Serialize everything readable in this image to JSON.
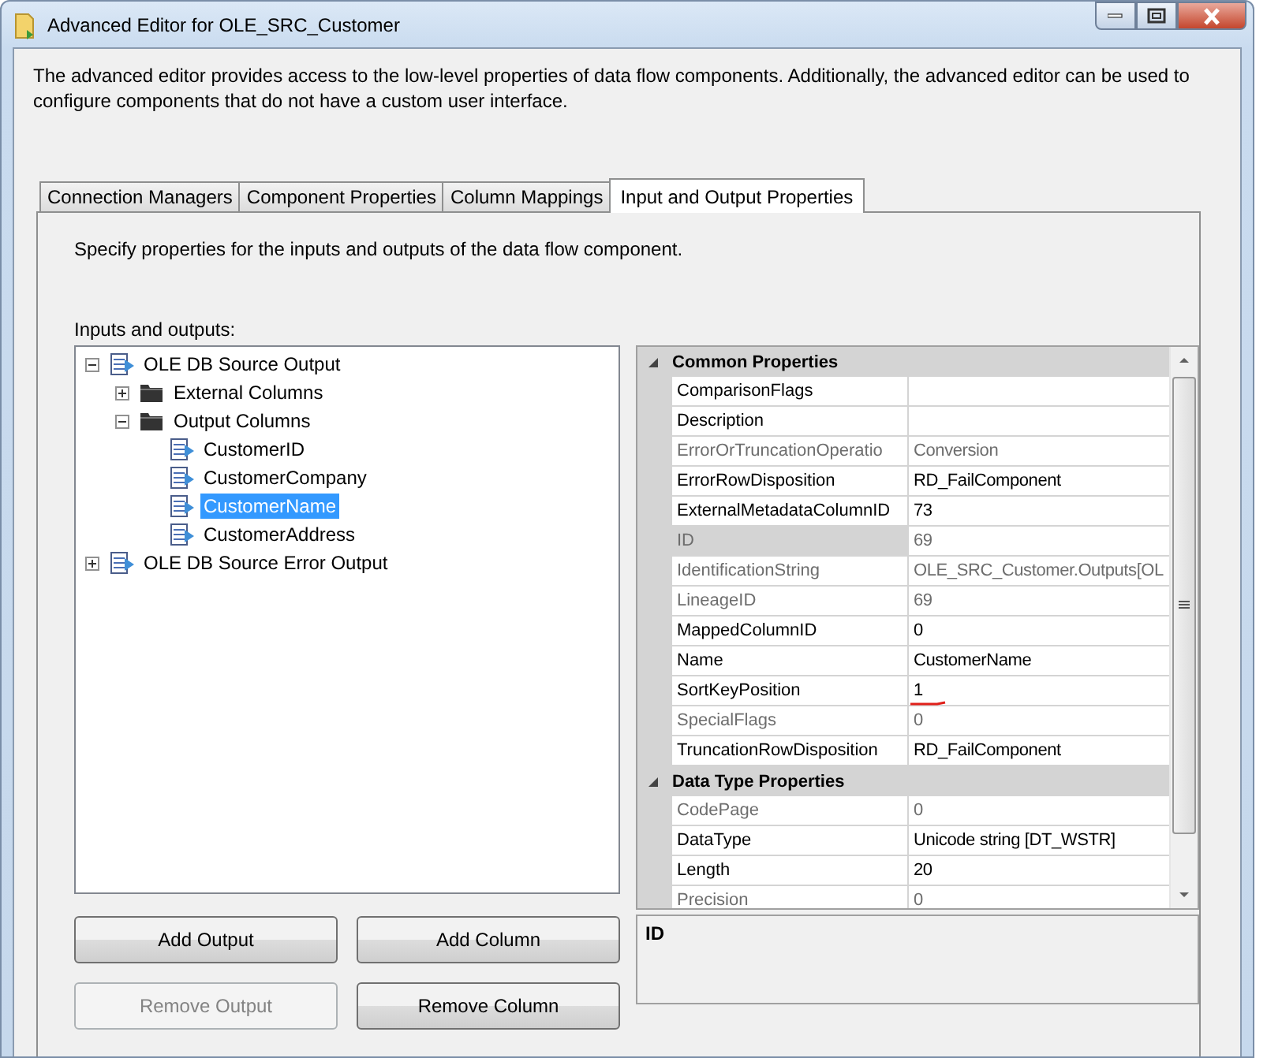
{
  "window": {
    "title": "Advanced Editor for OLE_SRC_Customer"
  },
  "intro": "The advanced editor provides access to the low-level properties of data flow components. Additionally, the advanced editor can be used to configure components that do not have a custom user interface.",
  "tabs": [
    {
      "label": "Connection Managers",
      "selected": false
    },
    {
      "label": "Component Properties",
      "selected": false
    },
    {
      "label": "Column Mappings",
      "selected": false
    },
    {
      "label": "Input and Output Properties",
      "selected": true
    }
  ],
  "panel_hint": "Specify properties for the inputs and outputs of the data flow component.",
  "tree_label": "Inputs and outputs:",
  "tree": [
    {
      "label": "OLE DB Source Output",
      "kind": "output",
      "expanded": true,
      "selected": false,
      "children": [
        {
          "label": "External Columns",
          "kind": "folder",
          "expanded": false,
          "selected": false
        },
        {
          "label": "Output Columns",
          "kind": "folder",
          "expanded": true,
          "selected": false,
          "children": [
            {
              "label": "CustomerID",
              "kind": "column",
              "selected": false
            },
            {
              "label": "CustomerCompany",
              "kind": "column",
              "selected": false
            },
            {
              "label": "CustomerName",
              "kind": "column",
              "selected": true
            },
            {
              "label": "CustomerAddress",
              "kind": "column",
              "selected": false
            }
          ]
        }
      ]
    },
    {
      "label": "OLE DB Source Error Output",
      "kind": "output",
      "expanded": false,
      "selected": false
    }
  ],
  "properties": [
    {
      "kind": "category",
      "label": "Common Properties",
      "expanded": true
    },
    {
      "kind": "property",
      "name": "ComparisonFlags",
      "disabled": false,
      "selected": false,
      "annotated": false
    },
    {
      "kind": "property",
      "name": "Description",
      "disabled": false,
      "selected": false,
      "annotated": false
    },
    {
      "kind": "property",
      "name": "ErrorOrTruncationOperatio",
      "value": "Conversion",
      "disabled": true,
      "selected": false,
      "annotated": false
    },
    {
      "kind": "property",
      "name": "ErrorRowDisposition",
      "value": "RD_FailComponent",
      "disabled": false,
      "selected": false,
      "annotated": false
    },
    {
      "kind": "property",
      "name": "ExternalMetadataColumnID",
      "value": "73",
      "disabled": false,
      "selected": false,
      "annotated": false
    },
    {
      "kind": "property",
      "name": "ID",
      "value": "69",
      "disabled": true,
      "selected": true,
      "annotated": false
    },
    {
      "kind": "property",
      "name": "IdentificationString",
      "value": "OLE_SRC_Customer.Outputs[OL",
      "disabled": true,
      "selected": false,
      "annotated": false
    },
    {
      "kind": "property",
      "name": "LineageID",
      "value": "69",
      "disabled": true,
      "selected": false,
      "annotated": false
    },
    {
      "kind": "property",
      "name": "MappedColumnID",
      "value": "0",
      "disabled": false,
      "selected": false,
      "annotated": false
    },
    {
      "kind": "property",
      "name": "Name",
      "value": "CustomerName",
      "disabled": false,
      "selected": false,
      "annotated": false
    },
    {
      "kind": "property",
      "name": "SortKeyPosition",
      "value": "1",
      "disabled": false,
      "selected": false,
      "annotated": true
    },
    {
      "kind": "property",
      "name": "SpecialFlags",
      "value": "0",
      "disabled": true,
      "selected": false,
      "annotated": false
    },
    {
      "kind": "property",
      "name": "TruncationRowDisposition",
      "value": "RD_FailComponent",
      "disabled": false,
      "selected": false,
      "annotated": false
    },
    {
      "kind": "category",
      "label": "Data Type Properties",
      "expanded": true
    },
    {
      "kind": "property",
      "name": "CodePage",
      "value": "0",
      "disabled": true,
      "selected": false,
      "annotated": false
    },
    {
      "kind": "property",
      "name": "DataType",
      "value": "Unicode string [DT_WSTR]",
      "disabled": false,
      "selected": false,
      "annotated": false
    },
    {
      "kind": "property",
      "name": "Length",
      "value": "20",
      "disabled": false,
      "selected": false,
      "annotated": false
    },
    {
      "kind": "property",
      "name": "Precision",
      "value": "0",
      "disabled": true,
      "selected": false,
      "annotated": false
    }
  ],
  "description_box": {
    "title": "ID"
  },
  "buttons": [
    {
      "label": "Add Output",
      "disabled": false
    },
    {
      "label": "Add Column",
      "disabled": false
    },
    {
      "label": "Remove Output",
      "disabled": true
    },
    {
      "label": "Remove Column",
      "disabled": false
    }
  ]
}
